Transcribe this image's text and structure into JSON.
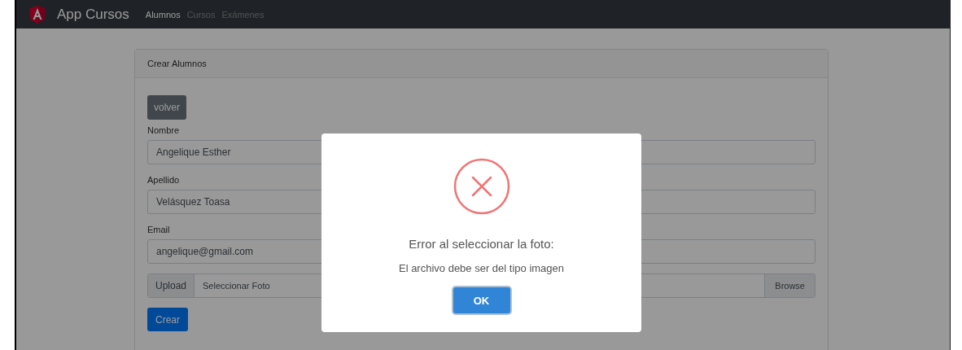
{
  "navbar": {
    "brand": "App Cursos",
    "links": [
      {
        "label": "Alumnos",
        "selected": true
      },
      {
        "label": "Cursos",
        "selected": false
      },
      {
        "label": "Exámenes",
        "selected": false
      }
    ]
  },
  "card": {
    "header": "Crear Alumnos",
    "back_button": "volver",
    "fields": [
      {
        "label": "Nombre",
        "value": "Angelique Esther"
      },
      {
        "label": "Apellido",
        "value": "Velásquez Toasa"
      },
      {
        "label": "Email",
        "value": "angelique@gmail.com"
      }
    ],
    "upload": {
      "prepend": "Upload",
      "label": "Seleccionar Foto",
      "button": "Browse"
    },
    "submit_button": "Crear"
  },
  "dialog": {
    "title": "Error al seleccionar la foto:",
    "message": "El archivo debe ser del tipo imagen",
    "button": "OK"
  }
}
